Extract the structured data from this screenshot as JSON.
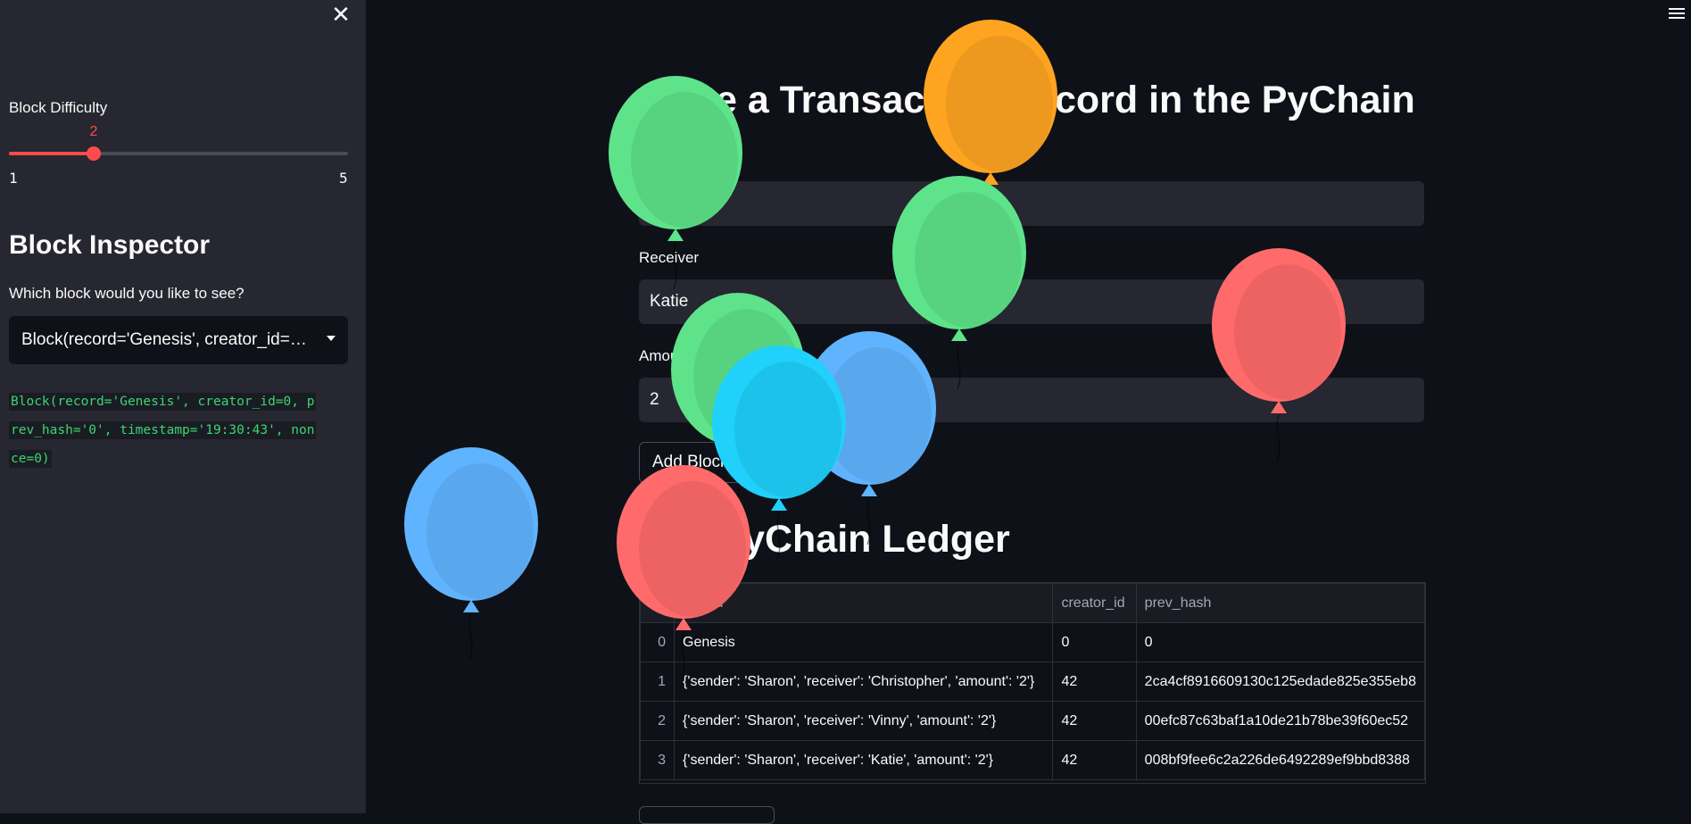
{
  "sidebar": {
    "close_icon": "close-icon",
    "difficulty_label": "Block Difficulty",
    "difficulty": {
      "value": "2",
      "min": "1",
      "max": "5",
      "value_num": 2,
      "min_num": 1,
      "max_num": 5
    },
    "inspector_heading": "Block Inspector",
    "select_question": "Which block would you like to see?",
    "select_value": "Block(record='Genesis', creator_id=0, prev_hash='0', timestamp='19:30:43', nonce=0)",
    "block_output": "Block(record='Genesis', creator_id=0, prev_hash='0', timestamp='19:30:43', nonce=0)"
  },
  "header": {
    "menu_icon": "hamburger-menu-icon"
  },
  "main": {
    "title": "Store a Transaction Record in the PyChain",
    "sender_value": "",
    "receiver_label": "Receiver",
    "receiver_value": "Katie",
    "amount_label": "Amount Sent",
    "amount_value": "2",
    "add_button": "Add Block",
    "ledger_title": "The PyChain Ledger",
    "ledger": {
      "columns": [
        "",
        "record",
        "creator_id",
        "prev_hash"
      ],
      "rows": [
        [
          "0",
          "Genesis",
          "0",
          "0"
        ],
        [
          "1",
          "{'sender': 'Sharon', 'receiver': 'Christopher', 'amount': '2'}",
          "42",
          "2ca4cf8916609130c125edade825e355eb8"
        ],
        [
          "2",
          "{'sender': 'Sharon', 'receiver': 'Vinny', 'amount': '2'}",
          "42",
          "00efc87c63baf1a10de21b78be39f60ec52"
        ],
        [
          "3",
          "{'sender': 'Sharon', 'receiver': 'Katie', 'amount': '2'}",
          "42",
          "008bf9fee6c2a226de6492289ef9bbd8388"
        ]
      ]
    }
  },
  "colors": {
    "accent": "#ff4b4b",
    "code_green": "#3dd56d",
    "balloon_green": "#5ee38a",
    "balloon_orange": "#ffa421",
    "balloon_red": "#ff6b6b",
    "balloon_blue": "#60b4ff",
    "balloon_cyan": "#1fd1fb"
  },
  "balloons": [
    {
      "color": "balloon_blue"
    },
    {
      "color": "balloon_green"
    },
    {
      "color": "balloon_orange"
    },
    {
      "color": "balloon_green"
    },
    {
      "color": "balloon_red"
    },
    {
      "color": "balloon_green"
    },
    {
      "color": "balloon_blue"
    },
    {
      "color": "balloon_cyan"
    },
    {
      "color": "balloon_red"
    }
  ]
}
